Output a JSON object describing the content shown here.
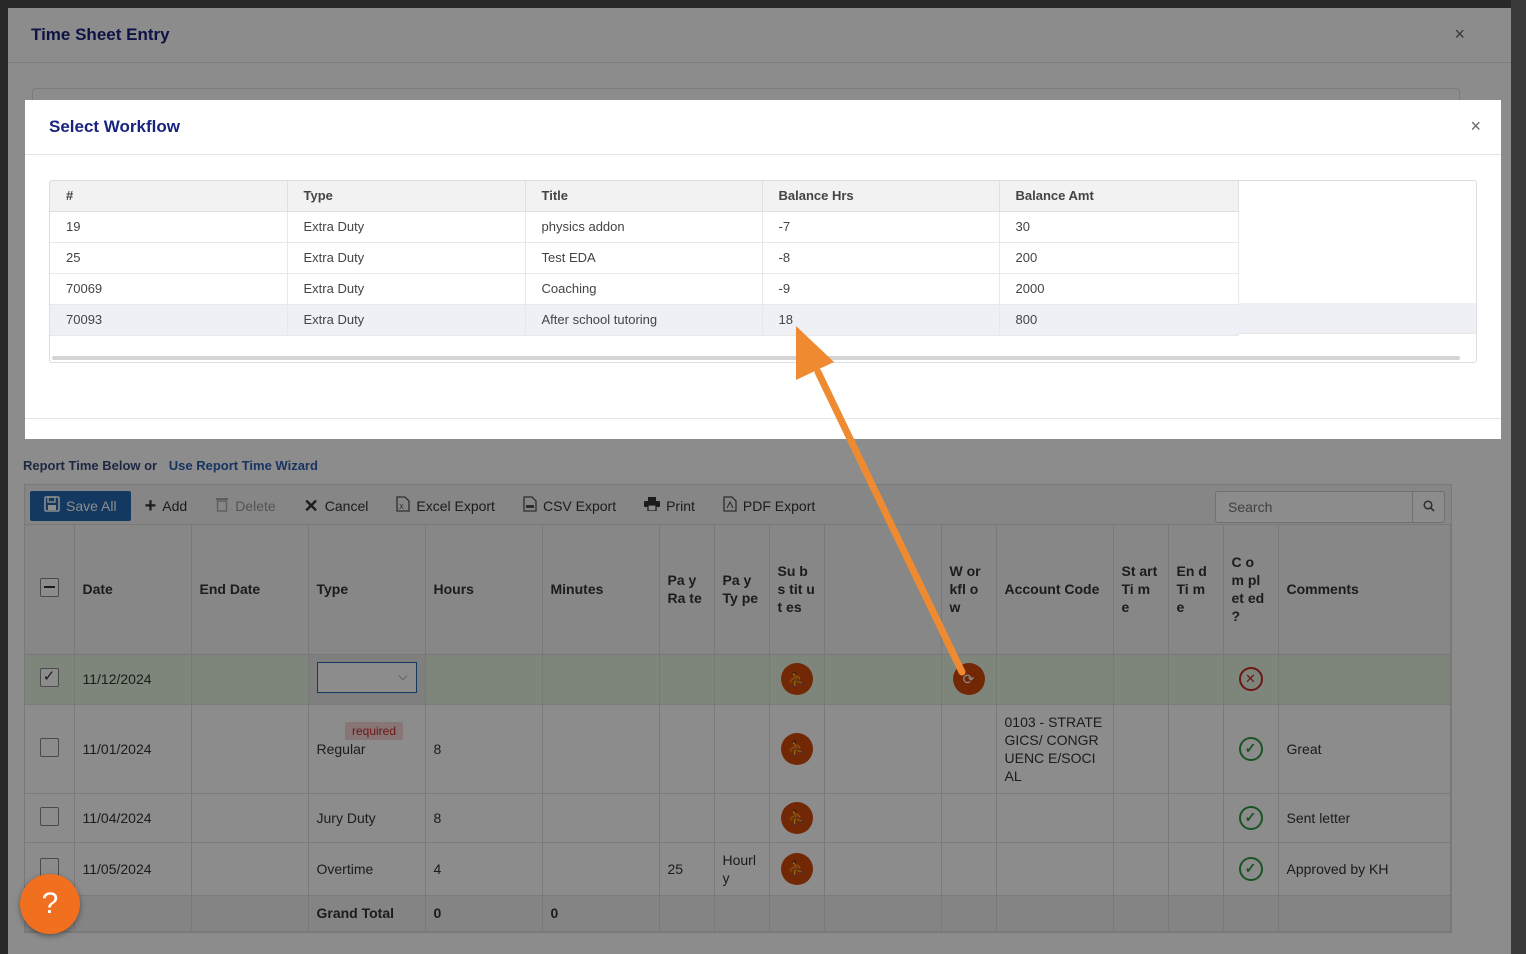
{
  "timesheet": {
    "title": "Time Sheet Entry",
    "close_glyph": "×",
    "report_text": "Report Time Below or",
    "wizard_link": "Use Report Time Wizard",
    "toolbar": {
      "save_all": "Save All",
      "add": "Add",
      "delete": "Delete",
      "cancel": "Cancel",
      "excel_export": "Excel Export",
      "csv_export": "CSV Export",
      "print": "Print",
      "pdf_export": "PDF Export",
      "search_placeholder": "Search"
    },
    "columns": {
      "date": "Date",
      "end_date": "End Date",
      "type": "Type",
      "hours": "Hours",
      "minutes": "Minutes",
      "pay_rate": "Pa y Ra te",
      "pay_type": "Pa y Ty pe",
      "substitutes": "Su bs tit ut es",
      "workflow": "W or kfl o w",
      "account_code": "Account Code",
      "start_time": "St art Ti m e",
      "end_time": "En d Ti m e",
      "completed": "C o m pl et ed ?",
      "comments": "Comments"
    },
    "rows": [
      {
        "date": "11/12/2024",
        "type": "",
        "hours": "",
        "pay_rate": "",
        "pay_type": "",
        "account_code": "",
        "comments": "",
        "required_tip": "required"
      },
      {
        "date": "11/01/2024",
        "type": "Regular",
        "hours": "8",
        "pay_rate": "",
        "pay_type": "",
        "account_code": "0103 - STRATEGICS/ CONGRUENC E/SOCIAL",
        "comments": "Great"
      },
      {
        "date": "11/04/2024",
        "type": "Jury Duty",
        "hours": "8",
        "pay_rate": "",
        "pay_type": "",
        "account_code": "",
        "comments": "Sent letter"
      },
      {
        "date": "11/05/2024",
        "type": "Overtime",
        "hours": "4",
        "pay_rate": "25",
        "pay_type": "Hourl y",
        "account_code": "",
        "comments": "Approved by KH"
      }
    ],
    "grand_total": {
      "label": "Grand Total",
      "hours": "0",
      "minutes": "0"
    }
  },
  "workflow_modal": {
    "title": "Select Workflow",
    "close_glyph": "×",
    "headers": [
      "#",
      "Type",
      "Title",
      "Balance Hrs",
      "Balance Amt"
    ],
    "rows": [
      {
        "num": "19",
        "type": "Extra Duty",
        "title": "physics addon",
        "balance_hrs": "-7",
        "balance_amt": "30"
      },
      {
        "num": "25",
        "type": "Extra Duty",
        "title": "Test EDA",
        "balance_hrs": "-8",
        "balance_amt": "200"
      },
      {
        "num": "70069",
        "type": "Extra Duty",
        "title": "Coaching",
        "balance_hrs": "-9",
        "balance_amt": "2000"
      },
      {
        "num": "70093",
        "type": "Extra Duty",
        "title": "After school tutoring",
        "balance_hrs": "18",
        "balance_amt": "800"
      }
    ]
  },
  "help_button": "?",
  "colors": {
    "accent_blue": "#2468b0",
    "title_navy": "#1a237e",
    "action_orange": "#d04a0a",
    "arrow_orange": "#f08a30",
    "success_green": "#2e9a3e",
    "error_red": "#c62828",
    "edit_row_green": "#e6f2de"
  }
}
